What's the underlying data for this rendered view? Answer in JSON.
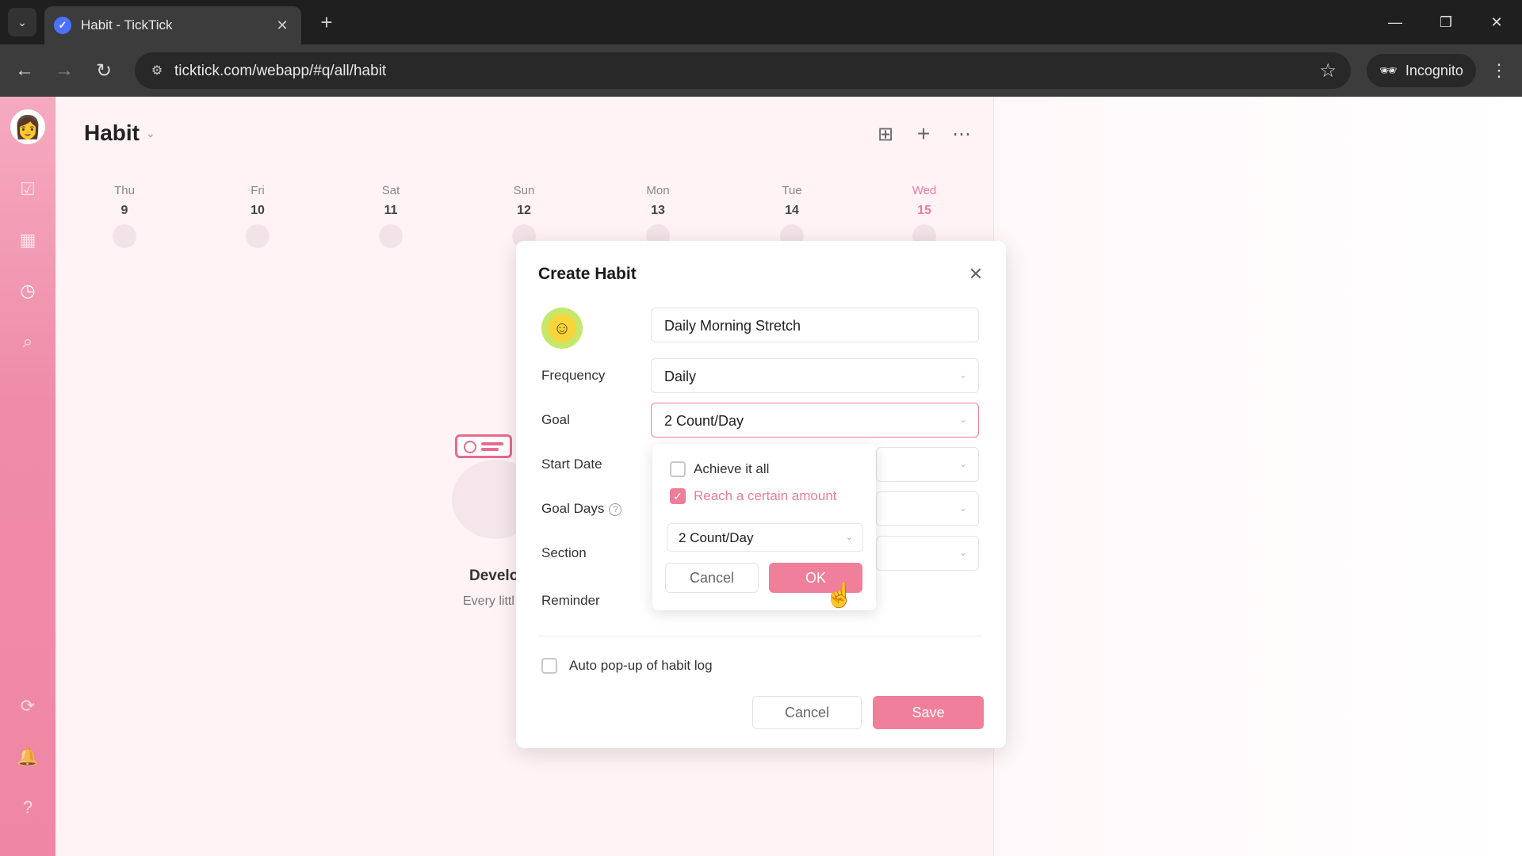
{
  "browser": {
    "tab_title": "Habit - TickTick",
    "url": "ticktick.com/webapp/#q/all/habit",
    "incognito_label": "Incognito"
  },
  "header": {
    "title": "Habit"
  },
  "week": [
    {
      "name": "Thu",
      "num": "9"
    },
    {
      "name": "Fri",
      "num": "10"
    },
    {
      "name": "Sat",
      "num": "11"
    },
    {
      "name": "Sun",
      "num": "12"
    },
    {
      "name": "Mon",
      "num": "13"
    },
    {
      "name": "Tue",
      "num": "14"
    },
    {
      "name": "Wed",
      "num": "15"
    }
  ],
  "empty_state": {
    "title": "Develo",
    "subtitle": "Every littl"
  },
  "modal": {
    "title": "Create Habit",
    "habit_name": "Daily Morning Stretch",
    "labels": {
      "frequency": "Frequency",
      "goal": "Goal",
      "start_date": "Start Date",
      "goal_days": "Goal Days",
      "section": "Section",
      "reminder": "Reminder"
    },
    "frequency_value": "Daily",
    "goal_value": "2 Count/Day",
    "auto_popup_label": "Auto pop-up of habit log",
    "auto_popup_checked": false,
    "cancel_label": "Cancel",
    "save_label": "Save"
  },
  "goal_popover": {
    "option_all": "Achieve it all",
    "option_amount": "Reach a certain amount",
    "option_amount_checked": true,
    "amount_value": "2 Count/Day",
    "cancel_label": "Cancel",
    "ok_label": "OK"
  },
  "colors": {
    "accent": "#ee7d99",
    "sidebar": "#f08ca8"
  }
}
